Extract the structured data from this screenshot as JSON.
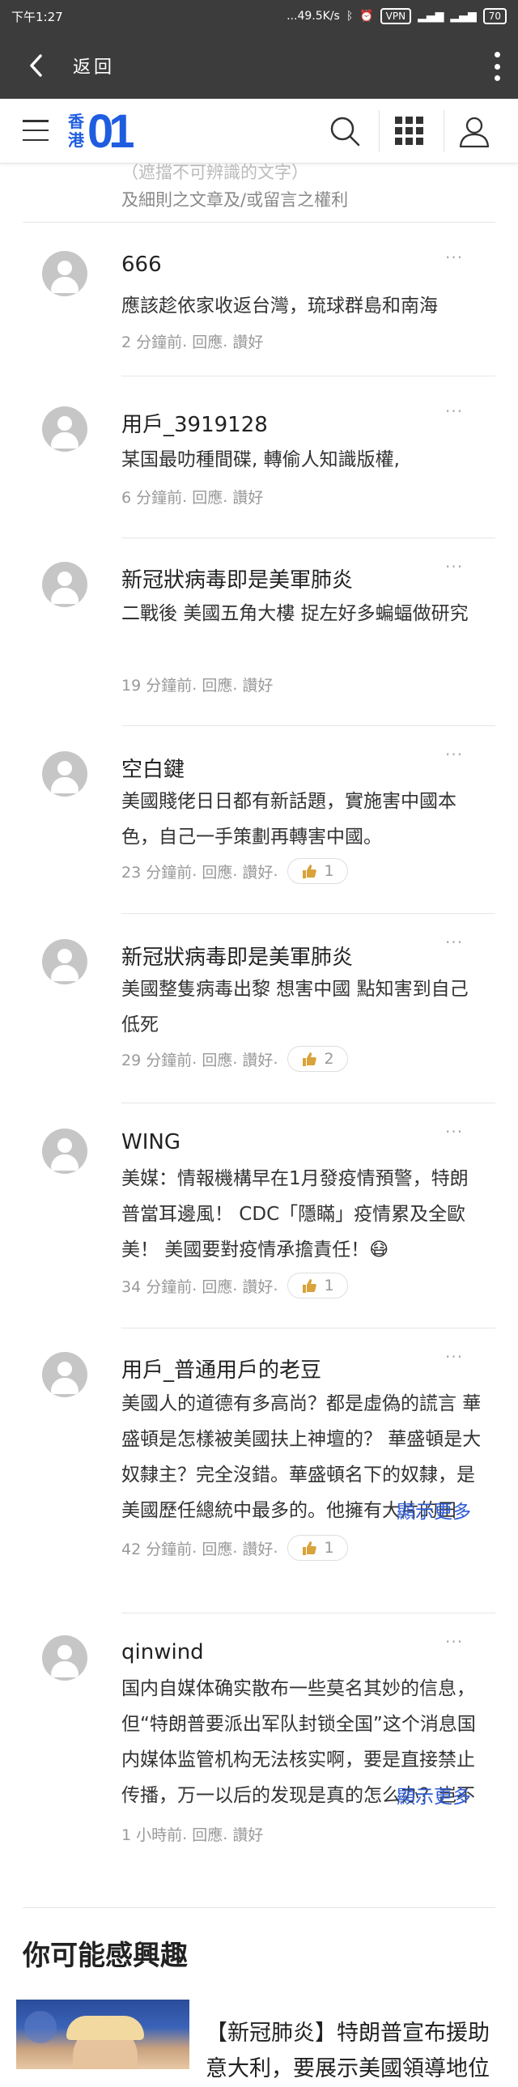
{
  "status_bar": {
    "time": "下午1:27",
    "network_speed": "...49.5K/s",
    "vpn_label": "VPN",
    "battery": "70"
  },
  "top_bar": {
    "back_label": "返回"
  },
  "header": {
    "logo_text_line1": "香",
    "logo_text_line2": "港",
    "logo_mark": "01"
  },
  "notice": {
    "line1": "（遮擋不可辨識的文字）",
    "line2": "及細則之文章及/或留言之權利"
  },
  "comments": [
    {
      "name": "666",
      "text": "應該趁依家收返台灣，琉球群島和南海",
      "time": "2 分鐘前",
      "reply": "回應",
      "like": "讚好",
      "likes": ""
    },
    {
      "name": "用戶_3919128",
      "text": "某国最叻種間碟, 轉偷人知識版權,",
      "time": "6 分鐘前",
      "reply": "回應",
      "like": "讚好",
      "likes": ""
    },
    {
      "name": "新冠狀病毒即是美軍肺炎",
      "text": "二戰後 美國五角大樓 捉左好多蝙蝠做研究",
      "time": "19 分鐘前",
      "reply": "回應",
      "like": "讚好",
      "likes": ""
    },
    {
      "name": "空白鍵",
      "text": "美國賤佬日日都有新話題，實施害中國本色，自己一手策劃再轉害中國。",
      "time": "23 分鐘前",
      "reply": "回應",
      "like": "讚好",
      "likes": "1"
    },
    {
      "name": "新冠狀病毒即是美軍肺炎",
      "text": "美國整隻病毒出黎 想害中國 點知害到自己 低死",
      "time": "29 分鐘前",
      "reply": "回應",
      "like": "讚好",
      "likes": "2"
    },
    {
      "name": "WING",
      "text": "美媒：情報機構早在1月發疫情預警，特朗普當耳邊風！ CDC「隱瞞」疫情累及全歐美！ 美國要對疫情承擔責任！😷",
      "time": "34 分鐘前",
      "reply": "回應",
      "like": "讚好",
      "likes": "1"
    },
    {
      "name": "用戶_普通用戶的老豆",
      "text": "美國人的道德有多高尚？都是虛偽的謊言 華盛頓是怎樣被美國扶上神壇的？ 華盛頓是大奴隸主？完全沒錯。華盛頓名下的奴隸，是美國歷任總統中最多的。他擁有大片的田莊，成〔...",
      "show_more": "顯示更多",
      "time": "42 分鐘前",
      "reply": "回應",
      "like": "讚好",
      "likes": "1"
    },
    {
      "name": "qinwind",
      "text": "国内自媒体确实散布一些莫名其妙的信息，但“特朗普要派出军队封锁全国”这个消息国内媒体监管机构无法核实啊，要是直接禁止传播，万一以后的发现是真的怎么办？岂不是又在“打...",
      "show_more": "顯示更多",
      "time": "1 小時前",
      "reply": "回應",
      "like": "讚好",
      "likes": ""
    }
  ],
  "recommend": {
    "section_title": "你可能感興趣",
    "article_title": "【新冠肺炎】特朗普宣布援助意大利，要展示美國領導地位"
  },
  "colors": {
    "accent": "#2d5bd6",
    "bar": "#3c3c3c"
  }
}
